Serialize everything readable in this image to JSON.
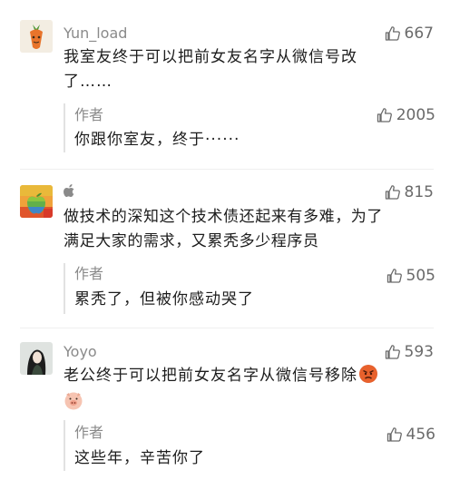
{
  "comments": [
    {
      "author": "Yun_load",
      "likes": "667",
      "avatar_icon": "carrot-avatar",
      "lines": [
        "我室友终于可以把前女友名字从微信号改",
        "了……"
      ],
      "reply": {
        "author": "作者",
        "likes": "2005",
        "text": "你跟你室友，终于······"
      }
    },
    {
      "author": "",
      "author_icon": "apple-icon",
      "likes": "815",
      "avatar_icon": "colorful-apple-avatar",
      "lines": [
        "做技术的深知这个技术债还起来有多难，为了",
        "满足大家的需求，又累秃多少程序员"
      ],
      "reply": {
        "author": "作者",
        "likes": "505",
        "text": "累秃了，但被你感动哭了"
      }
    },
    {
      "author": "Yoyo",
      "likes": "593",
      "avatar_icon": "woman-portrait-avatar",
      "lines": [
        "老公终于可以把前女友名字从微信号移除"
      ],
      "emojis": [
        "angry-face-emoji",
        "pig-face-emoji"
      ],
      "reply": {
        "author": "作者",
        "likes": "456",
        "text": "这些年，辛苦你了"
      }
    }
  ],
  "colors": {
    "meta": "#8a8a8a",
    "text": "#1d1d1d",
    "reply_bar": "#e2e2e2"
  }
}
